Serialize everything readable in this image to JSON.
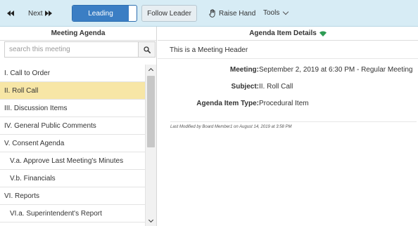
{
  "toolbar": {
    "prev_icon": "double-chevron-left-icon",
    "next_label": "Next",
    "next_icon": "double-chevron-right-icon",
    "leading_label": "Leading",
    "follow_leader_label": "Follow Leader",
    "raise_hand_label": "Raise Hand",
    "raise_hand_icon": "hand-icon",
    "tools_label": "Tools",
    "tools_icon": "chevron-down-icon",
    "accent_color": "#3b7ec4",
    "background_color": "#d7ecf5"
  },
  "left": {
    "title": "Meeting Agenda",
    "search": {
      "placeholder": "search this meeting",
      "value": "",
      "icon": "search-icon"
    },
    "selected_color": "#f7e6a6",
    "items": [
      {
        "label": "I. Call to Order"
      },
      {
        "label": "II. Roll Call"
      },
      {
        "label": "III. Discussion Items"
      },
      {
        "label": "IV. General Public Comments"
      },
      {
        "label": "V. Consent Agenda"
      },
      {
        "label": "V.a. Approve Last Meeting's Minutes"
      },
      {
        "label": "V.b. Financials"
      },
      {
        "label": "VI. Reports"
      },
      {
        "label": "VI.a. Superintendent's Report"
      }
    ]
  },
  "right": {
    "title": "Agenda Item Details",
    "title_icon": "wifi-signal-icon",
    "title_icon_color": "#2e9c54",
    "meeting_header": "This is a Meeting Header",
    "details": {
      "meeting_label": "Meeting:",
      "meeting_value": "September 2, 2019 at 6:30 PM - Regular Meeting",
      "subject_label": "Subject:",
      "subject_value": "II. Roll Call",
      "type_label": "Agenda Item Type:",
      "type_value": "Procedural Item"
    },
    "last_modified": "Last Modified by Board Member1 on August 14, 2019 at 3:58 PM"
  }
}
